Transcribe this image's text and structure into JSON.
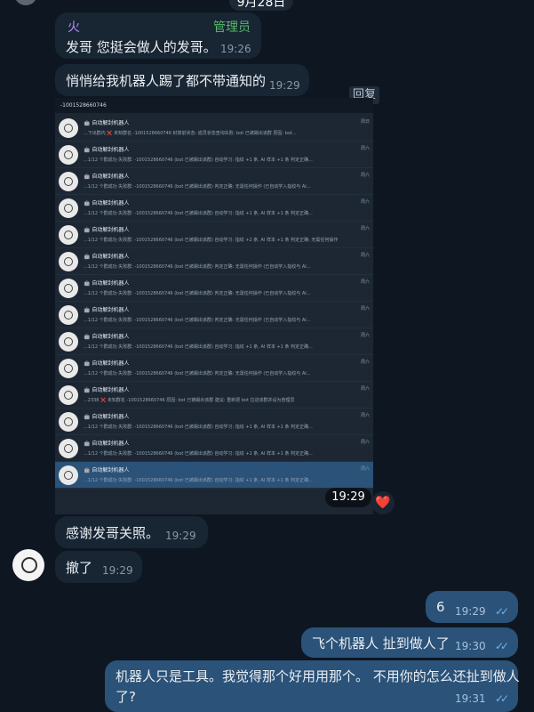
{
  "date_header": "9月28日",
  "messages": {
    "m1": {
      "sender": "火",
      "role": "管理员",
      "text": "发哥 您挺会做人的发哥。",
      "time": "19:26"
    },
    "m2": {
      "text": "悄悄给我机器人踢了都不带通知的",
      "time": "19:29"
    },
    "reply_label": "回复",
    "screenshot": {
      "time": "19:29",
      "reaction": "❤️",
      "search_text": "-1001528660746",
      "rows": [
        {
          "title": "🤖 自动解封机器人",
          "preview": "...下出群内 ❌ 未知群名 -1001528660746  封禁前状态: 成员状态查询失败: bot 已被踢出该群  原因: bot...",
          "date": "周日"
        },
        {
          "title": "🤖 自动解封机器人",
          "preview": "...1/12 个群成功 失败群: -1001528660746 (bot 已被踢出该群) 自动学习: 指纹 +1 条, AI 样本 +1 条 判定正确...",
          "date": "周六"
        },
        {
          "title": "🤖 自动解封机器人",
          "preview": "...1/12 个群成功 失败群: -1001528660746 (bot 已被踢出该群) 判定正确: 无需任何操作 (已自动学入指纹与 AI...",
          "date": "周六"
        },
        {
          "title": "🤖 自动解封机器人",
          "preview": "...1/12 个群成功 失败群: -1001528660746 (bot 已被踢出该群) 自动学习: 指纹 +1 条, AI 样本 +1 条 判定正确...",
          "date": "周六"
        },
        {
          "title": "🤖 自动解封机器人",
          "preview": "...1/12 个群成功 失败群: -1001528660746 (bot 已被踢出该群) 自动学习: 指纹 +2 条, AI 样本 +1 条 判定正确: 无需任何操作",
          "date": "周六"
        },
        {
          "title": "🤖 自动解封机器人",
          "preview": "...1/12 个群成功 失败群: -1001528660746 (bot 已被踢出该群) 判定正确: 无需任何操作 (已自动学入指纹与 AI...",
          "date": "周六"
        },
        {
          "title": "🤖 自动解封机器人",
          "preview": "...1/12 个群成功 失败群: -1001528660746 (bot 已被踢出该群) 判定正确: 无需任何操作 (已自动学入指纹与 AI...",
          "date": "周六"
        },
        {
          "title": "🤖 自动解封机器人",
          "preview": "...1/12 个群成功 失败群: -1001528660746 (bot 已被踢出该群) 判定正确: 无需任何操作 (已自动学入指纹与 AI...",
          "date": "周六"
        },
        {
          "title": "🤖 自动解封机器人",
          "preview": "...1/12 个群成功 失败群: -1001528660746 (bot 已被踢出该群) 自动学习: 指纹 +1 条, AI 样本 +1 条 判定正确...",
          "date": "周六"
        },
        {
          "title": "🤖 自动解封机器人",
          "preview": "...1/12 个群成功 失败群: -1001528660746 (bot 已被踢出该群) 判定正确: 无需任何操作 (已自动学入指纹与 AI...",
          "date": "周六"
        },
        {
          "title": "🤖 自动解封机器人",
          "preview": "...2338 ❌ 未知群名 -1001528660746  原因: bot 已被踢出该群  建议: 重新把 bot 拉进该群并设为管理员",
          "date": "周六"
        },
        {
          "title": "🤖 自动解封机器人",
          "preview": "...1/12 个群成功 失败群: -1001528660746 (bot 已被踢出该群) 自动学习: 指纹 +1 条, AI 样本 +1 条 判定正确...",
          "date": "周六"
        },
        {
          "title": "🤖 自动解封机器人",
          "preview": "...1/12 个群成功 失败群: -1001528660746 (bot 已被踢出该群) 自动学习: 指纹 +1 条, AI 样本 +1 条 判定正确...",
          "date": "周六"
        },
        {
          "title": "🤖 自动解封机器人",
          "preview": "...1/12 个群成功 失败群: -1001528660746 (bot 已被踢出该群) 自动学习: 指纹 +1 条, AI 样本 +1 条 判定正确...",
          "date": "周六"
        }
      ]
    },
    "m3": {
      "text": "感谢发哥关照。",
      "time": "19:29"
    },
    "m4": {
      "text": "撤了",
      "time": "19:29"
    },
    "o1": {
      "text": "6",
      "time": "19:29",
      "ticks": "✓✓"
    },
    "o2": {
      "text": "飞个机器人 扯到做人了",
      "time": "19:30",
      "ticks": "✓✓"
    },
    "o3": {
      "line1": "机器人只是工具。我觉得那个好用用那个。 不用你的怎么还扯到做人",
      "line2": "了?",
      "time": "19:31",
      "ticks": "✓✓"
    }
  },
  "colors": {
    "background": "#0e1621",
    "incoming": "#182533",
    "outgoing": "#2b5278",
    "admin": "#59b86b",
    "sender": "#b38cff",
    "read_ticks": "#6fb3f0"
  }
}
